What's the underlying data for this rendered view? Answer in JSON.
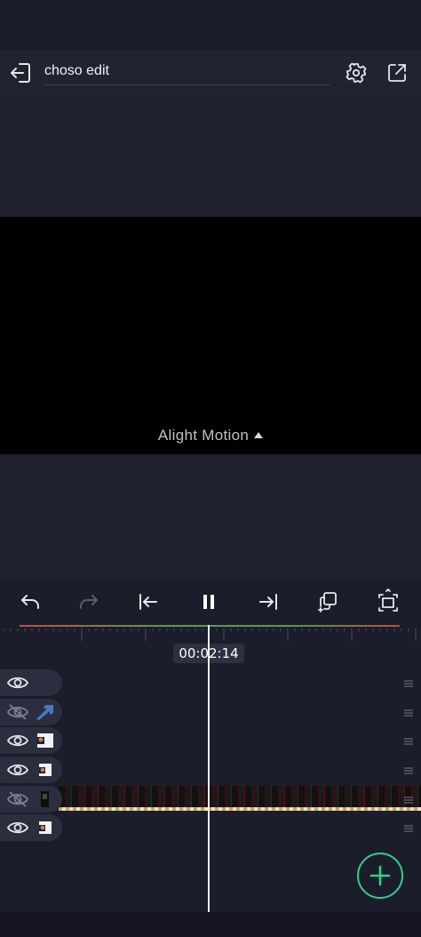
{
  "project": {
    "title": "choso edit"
  },
  "preview": {
    "watermark": "Alight Motion"
  },
  "toolbar": {
    "buttons": [
      "undo-icon",
      "redo-icon",
      "skip-to-start-icon",
      "pause-icon",
      "skip-to-end-icon",
      "duplicate-icon",
      "fit-frame-icon"
    ]
  },
  "timeline": {
    "timecode": "00:02:14",
    "layers": [
      {
        "visible": true,
        "thumb": "none"
      },
      {
        "visible": false,
        "thumb": "arrow"
      },
      {
        "visible": true,
        "thumb": "image"
      },
      {
        "visible": true,
        "thumb": "image"
      },
      {
        "visible": false,
        "thumb": "video"
      },
      {
        "visible": true,
        "thumb": "image"
      }
    ]
  },
  "colors": {
    "accent": "#2fd08a",
    "background": "#1b1d2b",
    "panel": "#2b2e3f"
  }
}
